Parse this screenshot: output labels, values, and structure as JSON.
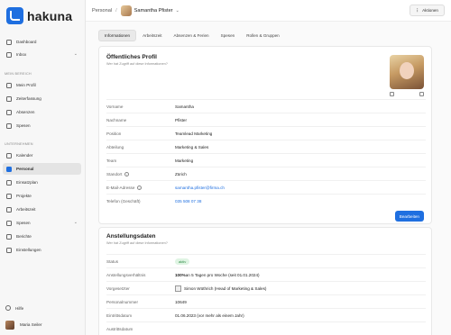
{
  "app": {
    "name": "hakuna"
  },
  "sidebar": {
    "top_items": [
      {
        "label": "Dashboard",
        "icon": "home-icon"
      },
      {
        "label": "Inbox",
        "icon": "inbox-icon"
      }
    ],
    "section_mein": "MEIN BEREICH",
    "mein_items": [
      {
        "label": "Mein Profil",
        "icon": "user-icon"
      },
      {
        "label": "Zeiterfassung",
        "icon": "clock-icon"
      },
      {
        "label": "Absenzen",
        "icon": "calendar-icon"
      },
      {
        "label": "Spesen",
        "icon": "receipt-icon"
      }
    ],
    "section_unternehmen": "UNTERNEHMEN",
    "company_items": [
      {
        "label": "Kalender",
        "icon": "calendar-icon"
      },
      {
        "label": "Personal",
        "icon": "people-icon"
      },
      {
        "label": "Einsatzplan",
        "icon": "plan-icon"
      },
      {
        "label": "Projekte",
        "icon": "folder-icon"
      },
      {
        "label": "Arbeitszeit",
        "icon": "clock-icon"
      },
      {
        "label": "Spesen",
        "icon": "receipt-icon"
      },
      {
        "label": "Berichte",
        "icon": "chart-icon"
      },
      {
        "label": "Einstellungen",
        "icon": "gear-icon"
      }
    ],
    "help": "Hilfe",
    "user": "Maria Seiler"
  },
  "header": {
    "breadcrumb_root": "Personal",
    "person": "Samantha Pfister",
    "actions": "Aktionen"
  },
  "tabs": [
    "Informationen",
    "Arbeitszeit",
    "Absenzen & Ferien",
    "Spesen",
    "Rollen & Gruppen"
  ],
  "profile": {
    "title": "Öffentliches Profil",
    "subtitle": "Wer hat Zugriff auf diese Informationen?",
    "fields": [
      {
        "key": "Vorname",
        "value": "Samantha"
      },
      {
        "key": "Nachname",
        "value": "Pfister"
      },
      {
        "key": "Position",
        "value": "Teamlead Marketing"
      },
      {
        "key": "Abteilung",
        "value": "Marketing & Sales"
      },
      {
        "key": "Team",
        "value": "Marketing"
      },
      {
        "key": "Standort",
        "value": "Zürich"
      },
      {
        "key": "E-Mail-Adresse",
        "value": "samantha.pfister@firma.ch"
      },
      {
        "key": "Telefon (Geschäft)",
        "value": "035 508 07 38"
      }
    ],
    "edit_button": "Bearbeiten"
  },
  "employment": {
    "title": "Anstellungsdaten",
    "subtitle": "Wer hat Zugriff auf diese Informationen?",
    "status_key": "Status",
    "status_value": "aktiv",
    "pensum_key": "Anstellungsverhältnis",
    "pensum_bold": "100%",
    "pensum_rest": " an 5 Tagen pro Woche (seit 01.01.2024)",
    "supervisor_key": "Vorgesetzter",
    "supervisor_value": "Simon Wüthrich (Head of Marketing & Sales)",
    "number_key": "Personalnummer",
    "number_value": "10649",
    "entry_key": "Eintrittsdatum",
    "entry_value": "01.06.2023 (vor mehr als einem Jahr)",
    "exit_key": "Austrittsdatum"
  },
  "colors": {
    "accent": "#1f6fe0",
    "status_green": "#2e8b46"
  }
}
